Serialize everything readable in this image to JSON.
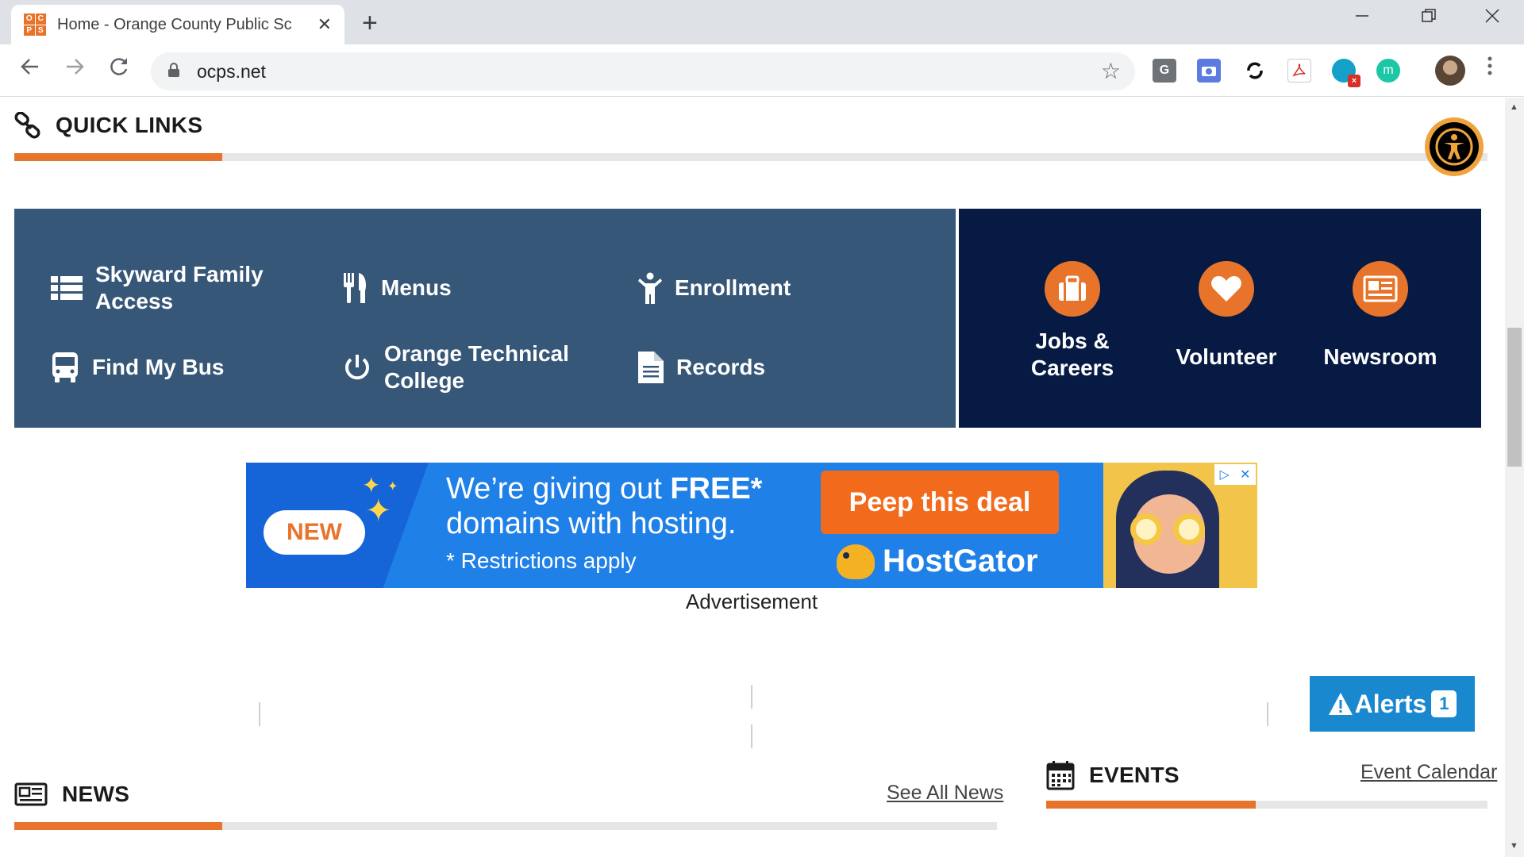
{
  "browser": {
    "tab_title": "Home - Orange County Public Sc",
    "favicon_letters": [
      "O",
      "C",
      "P",
      "S"
    ],
    "url": "ocps.net",
    "extensions": [
      {
        "name": "g-extension-icon",
        "label": "G",
        "color": "#5f6368"
      },
      {
        "name": "camera-extension-icon",
        "label": "",
        "color": "#5b7be0"
      },
      {
        "name": "sync-extension-icon",
        "label": "",
        "color": "#111111"
      },
      {
        "name": "pdf-extension-icon",
        "label": "",
        "color": "#d93025"
      },
      {
        "name": "grammar-extension-icon",
        "label": "",
        "color": "#15a0c8"
      },
      {
        "name": "m-extension-icon",
        "label": "m",
        "color": "#1cc7a6"
      }
    ]
  },
  "quick_links": {
    "title": "QUICK LINKS",
    "left_items": [
      {
        "label": "Skyward Family Access",
        "icon": "list-icon"
      },
      {
        "label": "Menus",
        "icon": "utensils-icon"
      },
      {
        "label": "Enrollment",
        "icon": "person-icon"
      },
      {
        "label": "Find My Bus",
        "icon": "bus-icon"
      },
      {
        "label": "Orange Technical College",
        "icon": "power-icon"
      },
      {
        "label": "Records",
        "icon": "document-icon"
      }
    ],
    "right_items": [
      {
        "label": "Jobs & Careers",
        "icon": "briefcase-icon"
      },
      {
        "label": "Volunteer",
        "icon": "heart-icon"
      },
      {
        "label": "Newsroom",
        "icon": "newspaper-icon"
      }
    ]
  },
  "ad": {
    "badge": "NEW",
    "line1_prefix": "We’re giving out ",
    "line1_bold": "FREE*",
    "line2": "domains with hosting.",
    "line3": "* Restrictions apply",
    "cta": "Peep this deal",
    "brand": "HostGator",
    "label": "Advertisement"
  },
  "news": {
    "title": "NEWS",
    "link": "See All News"
  },
  "events": {
    "title": "EVENTS",
    "link": "Event Calendar"
  },
  "alerts": {
    "label": "Alerts",
    "count": "1"
  },
  "colors": {
    "accent_orange": "#e8742b",
    "quicklinks_left_bg": "#365778",
    "quicklinks_right_bg": "#061a43",
    "alerts_blue": "#1a88cf"
  }
}
